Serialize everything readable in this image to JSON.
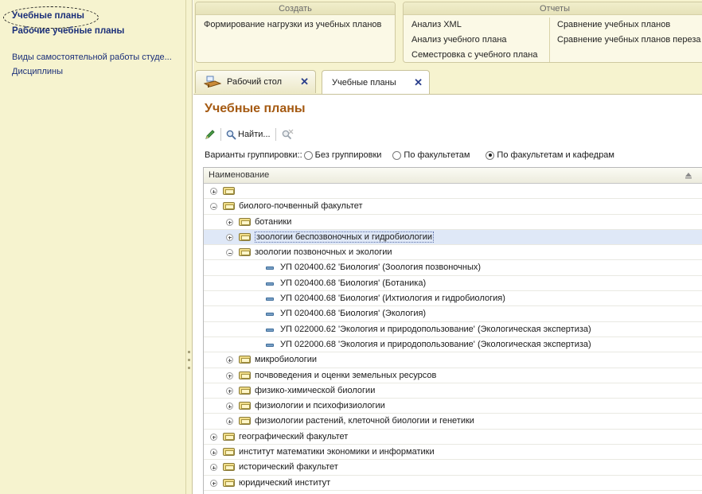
{
  "left_nav": {
    "items": [
      {
        "label": "Учебные планы",
        "style": "bold"
      },
      {
        "label": "Рабочие учебные планы",
        "style": "bold"
      },
      {
        "label": "Виды самостоятельной работы студе...",
        "style": "link"
      },
      {
        "label": "Дисциплины",
        "style": "link"
      }
    ]
  },
  "commands": {
    "create": {
      "title": "Создать",
      "items": [
        "Формирование нагрузки из учебных планов"
      ]
    },
    "reports": {
      "title": "Отчеты",
      "col1": [
        "Анализ XML",
        "Анализ учебного плана",
        "Семестровка с учебного плана"
      ],
      "col2": [
        "Сравнение учебных планов",
        "Сравнение учебных планов переза"
      ]
    }
  },
  "tabs": [
    {
      "label": "Рабочий стол",
      "icon": "desktop-icon",
      "close": "✕"
    },
    {
      "label": "Учебные планы",
      "close": "✕",
      "active": true
    }
  ],
  "content": {
    "title": "Учебные планы",
    "toolbar": {
      "find_label": "Найти..."
    },
    "grouping": {
      "label": "Варианты группировки::",
      "options": [
        {
          "label": "Без группировки",
          "selected": false
        },
        {
          "label": "По факультетам",
          "selected": false
        },
        {
          "label": "По факультетам и кафедрам",
          "selected": true
        }
      ]
    },
    "table": {
      "header": "Наименование",
      "rows": [
        {
          "level": 0,
          "kind": "folder",
          "state": "plus",
          "label": ""
        },
        {
          "level": 0,
          "kind": "folder",
          "state": "minus",
          "label": "биолого-почвенный факультет"
        },
        {
          "level": 1,
          "kind": "folder",
          "state": "plus",
          "label": "ботаники"
        },
        {
          "level": 1,
          "kind": "folder",
          "state": "plus",
          "label": "зоологии беспозвоночных и гидробиологии",
          "selected": true
        },
        {
          "level": 1,
          "kind": "folder",
          "state": "minus",
          "label": "зоологии позвоночных и экологии"
        },
        {
          "level": 2,
          "kind": "leaf",
          "label": "УП 020400.62 'Биология' (Зоология позвоночных)"
        },
        {
          "level": 2,
          "kind": "leaf",
          "label": "УП 020400.68 'Биология' (Ботаника)"
        },
        {
          "level": 2,
          "kind": "leaf",
          "label": "УП 020400.68 'Биология' (Ихтиология и гидробиология)"
        },
        {
          "level": 2,
          "kind": "leaf",
          "label": "УП 020400.68 'Биология' (Экология)"
        },
        {
          "level": 2,
          "kind": "leaf",
          "label": "УП 022000.62 'Экология и природопользование' (Экологическая экспертиза)"
        },
        {
          "level": 2,
          "kind": "leaf",
          "label": "УП 022000.68 'Экология и природопользование' (Экологическая экспертиза)"
        },
        {
          "level": 1,
          "kind": "folder",
          "state": "plus",
          "label": "микробиологии"
        },
        {
          "level": 1,
          "kind": "folder",
          "state": "plus",
          "label": "почвоведения и оценки земельных ресурсов"
        },
        {
          "level": 1,
          "kind": "folder",
          "state": "plus",
          "label": "физико-химической биологии"
        },
        {
          "level": 1,
          "kind": "folder",
          "state": "plus",
          "label": "физиологии и психофизиологии"
        },
        {
          "level": 1,
          "kind": "folder",
          "state": "plus",
          "label": "физиологии растений, клеточной биологии и генетики"
        },
        {
          "level": 0,
          "kind": "folder",
          "state": "plus",
          "label": "географический факультет"
        },
        {
          "level": 0,
          "kind": "folder",
          "state": "plus",
          "label": "институт математики экономики и информатики"
        },
        {
          "level": 0,
          "kind": "folder",
          "state": "plus",
          "label": "исторический факультет"
        },
        {
          "level": 0,
          "kind": "folder",
          "state": "plus",
          "label": "юридический институт"
        }
      ]
    }
  },
  "colors": {
    "panel_bg": "#f6f3cf",
    "title": "#a55a12",
    "nav_link": "#1b2f79",
    "selection": "#dfe8f7"
  }
}
